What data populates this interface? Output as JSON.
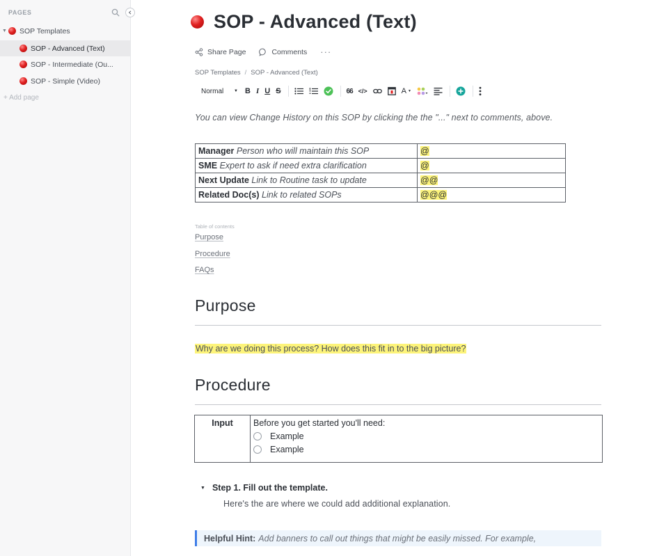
{
  "sidebar": {
    "header": "PAGES",
    "items": [
      {
        "label": "SOP Templates"
      },
      {
        "label": "SOP - Advanced (Text)"
      },
      {
        "label": "SOP - Intermediate (Ou..."
      },
      {
        "label": "SOP - Simple (Video)"
      }
    ],
    "add_page": "+ Add page",
    "active_index": 1
  },
  "page": {
    "title": "SOP - Advanced (Text)",
    "icon": "red-circle-icon"
  },
  "actions": {
    "share": "Share Page",
    "comments": "Comments",
    "more": "···"
  },
  "breadcrumb": {
    "parent": "SOP Templates",
    "separator": "/",
    "current": "SOP - Advanced (Text)"
  },
  "toolbar": {
    "format": "Normal",
    "bold": "B",
    "italic": "I",
    "underline": "U",
    "strike": "S",
    "quote": "66",
    "code": "</>",
    "text_color": "A"
  },
  "intro": "You can view Change History on this SOP by clicking the the \"...\" next to comments, above.",
  "meta_rows": [
    {
      "key": "Manager",
      "hint": "Person who will maintain this SOP",
      "value": "@"
    },
    {
      "key": "SME",
      "hint": "Expert to ask if need extra clarification",
      "value": "@"
    },
    {
      "key": "Next Update",
      "hint": "Link to Routine task to update",
      "value": "@@"
    },
    {
      "key": "Related Doc(s)",
      "hint": "Link to related SOPs",
      "value": "@@@"
    }
  ],
  "toc": {
    "label": "Table of contents",
    "links": [
      "Purpose",
      "Procedure",
      "FAQs"
    ]
  },
  "purpose": {
    "heading": "Purpose",
    "text": "Why are we doing this process? How does this fit in to the big picture?"
  },
  "procedure": {
    "heading": "Procedure",
    "input_label": "Input",
    "input_intro": "Before you get started you'll need:",
    "checklist": [
      "Example",
      "Example"
    ],
    "step_title": "Step 1. Fill out the template.",
    "step_desc": "Here's the are where we could add additional explanation."
  },
  "hint": {
    "label": "Helpful Hint:",
    "text": "Add banners to call out things that might be easily missed. For example,"
  },
  "colors": {
    "highlight": "#fdf47a",
    "accent_blue": "#3f7ee8",
    "green_check": "#4cc157",
    "add_green": "#16a59b",
    "dot_red": "#e02020"
  }
}
